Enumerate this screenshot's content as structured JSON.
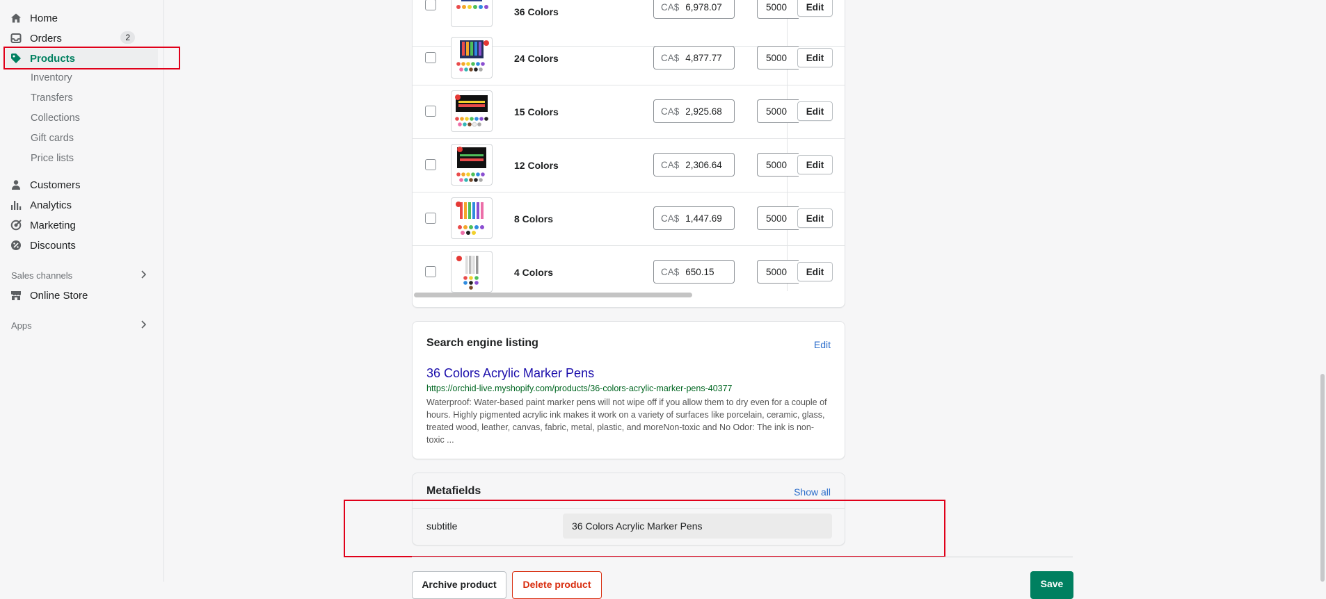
{
  "sidebar": {
    "home": "Home",
    "orders": "Orders",
    "orders_badge": "2",
    "products": "Products",
    "sub": [
      "Inventory",
      "Transfers",
      "Collections",
      "Gift cards",
      "Price lists"
    ],
    "customers": "Customers",
    "analytics": "Analytics",
    "marketing": "Marketing",
    "discounts": "Discounts",
    "sales_channels": "Sales channels",
    "online_store": "Online Store",
    "apps": "Apps"
  },
  "variants": {
    "currency": "CA$",
    "edit_label": "Edit",
    "rows": [
      {
        "name": "36 Colors",
        "price": "6,978.07",
        "qty": "5000"
      },
      {
        "name": "24 Colors",
        "price": "4,877.77",
        "qty": "5000"
      },
      {
        "name": "15 Colors",
        "price": "2,925.68",
        "qty": "5000"
      },
      {
        "name": "12 Colors",
        "price": "2,306.64",
        "qty": "5000"
      },
      {
        "name": "8 Colors",
        "price": "1,447.69",
        "qty": "5000"
      },
      {
        "name": "4 Colors",
        "price": "650.15",
        "qty": "5000"
      }
    ]
  },
  "seo": {
    "heading": "Search engine listing",
    "edit": "Edit",
    "title": "36 Colors Acrylic Marker Pens",
    "url": "https://orchid-live.myshopify.com/products/36-colors-acrylic-marker-pens-40377",
    "description": "Waterproof: Water-based paint marker pens will not wipe off if you allow them to dry even for a couple of hours. Highly pigmented acrylic ink makes it work on a variety of surfaces like porcelain, ceramic, glass, treated wood, leather, canvas, fabric, metal, plastic, and moreNon-toxic and No Odor: The ink is non-toxic ..."
  },
  "metafields": {
    "heading": "Metafields",
    "show_all": "Show all",
    "field_label": "subtitle",
    "field_value": "36 Colors Acrylic Marker Pens"
  },
  "footer": {
    "archive": "Archive product",
    "delete": "Delete product",
    "save": "Save"
  },
  "colors": {
    "accent": "#008060",
    "link": "#2c6ecb",
    "seo_title": "#1a0dab",
    "seo_url": "#006621",
    "highlight": "#e0001a"
  },
  "icons": [
    "home-icon",
    "orders-icon",
    "tag-icon",
    "person-icon",
    "bar-chart-icon",
    "target-icon",
    "discount-icon",
    "store-icon",
    "chevron-right-icon"
  ]
}
